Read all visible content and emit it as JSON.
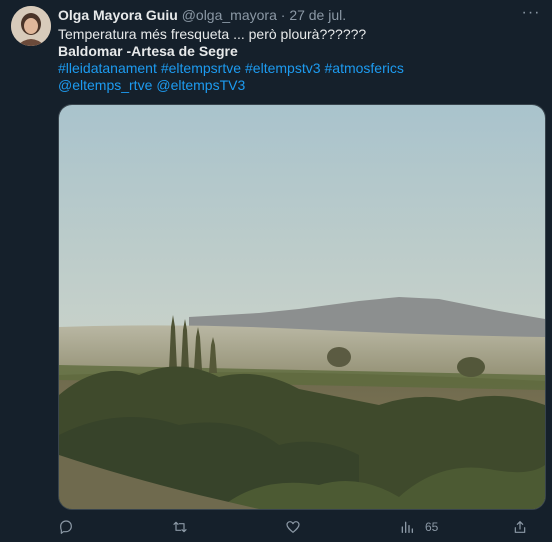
{
  "tweet": {
    "author_name": "Olga Mayora Guiu",
    "handle": "@olga_mayora",
    "separator": "·",
    "date": "27 de jul.",
    "more_label": "···",
    "text_line1": "Temperatura més fresqueta ... però plourà??????",
    "text_line2": "Baldomar -Artesa de Segre",
    "hashtags": [
      "#lleidatanament",
      "#eltempsrtve",
      "#eltempstv3",
      "#atmosferics"
    ],
    "mentions": [
      "@eltemps_rtve",
      "@eltempsTV3"
    ]
  },
  "actions": {
    "reply_icon": "reply-icon",
    "retweet_icon": "retweet-icon",
    "like_icon": "heart-icon",
    "views_icon": "views-icon",
    "views_count": "65",
    "share_icon": "share-icon"
  },
  "colors": {
    "background": "#15202b",
    "text": "#e7e9ea",
    "muted": "#8b98a5",
    "link": "#1d9bf0"
  }
}
